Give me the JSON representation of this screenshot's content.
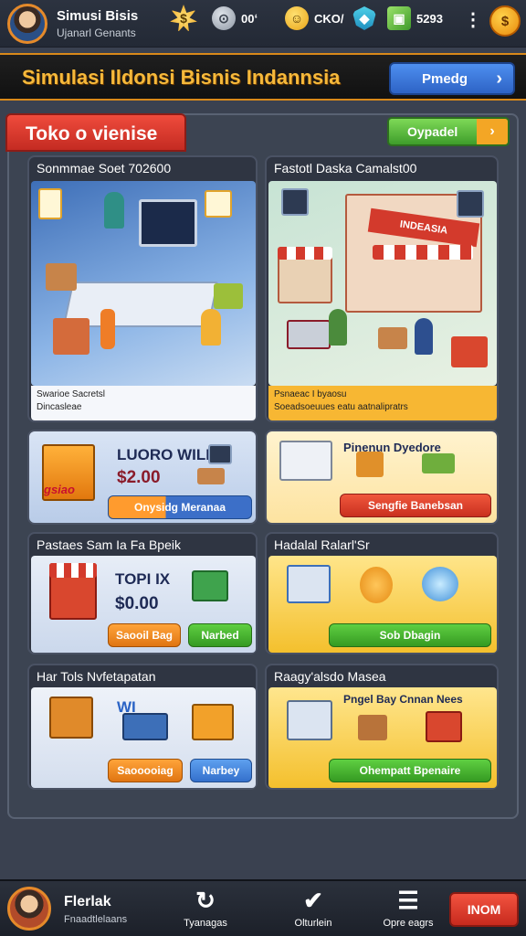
{
  "hud": {
    "player_name": "Simusi Bisis",
    "player_sub": "Ujanarl Genants",
    "res_silver": "00ʻ",
    "res_gold": "CKO/",
    "res_gems": "5293",
    "menu_glyph": "⋮",
    "coin_glyph": "$"
  },
  "banner": {
    "title": "Simulasi Ildonsi Bisnis Indannsia",
    "button_label": "Pmedg",
    "button_chevron": "›"
  },
  "panel": {
    "tab_label": "Toko o vienise",
    "upgrade_label": "Oypadel",
    "upgrade_arrow": "›"
  },
  "cards": {
    "c1": {
      "title": "Sonmmae Soet 702600",
      "caption_line1": "Swarioe Sacretsl",
      "caption_line2": "Dincasleae"
    },
    "c2": {
      "title": "Fastotl Daska Camalst00",
      "caption_line1": "Psnaeac I byaosu",
      "caption_line2": "Soeadsoeuues eatu aatnalipratrs",
      "store_sign": "INDEASIA"
    },
    "c3": {
      "label": "LUORO WILL",
      "price": "$2.00",
      "pill": "Onysidg Meranaa",
      "crate_text": "gsiao"
    },
    "c4": {
      "label": "Pinenun Dyedore",
      "pill": "Sengfie Banebsan"
    },
    "c5": {
      "title": "Pastaes Sam Ia Fa Bpeik",
      "label": "TOPI IX",
      "price": "$0.00",
      "pill_left": "Saooil Bag",
      "pill_right": "Narbed"
    },
    "c6": {
      "title": "Hadalal Ralarl'Sr",
      "pill": "Sob Dbagin"
    },
    "c7": {
      "title": "Har Tols Nvfetapatan",
      "label": "WI",
      "pill_left": "Saooooiag",
      "pill_right": "Narbey"
    },
    "c8": {
      "title": "Raagy'alsdo Masea",
      "label": "Pngel Bay Cnnan Nees",
      "pill": "Ohempatt Bpenaire"
    }
  },
  "bottom": {
    "name": "Flerlak",
    "sub": "Fnaadtlelaans",
    "nav1_label": "Tyanagas",
    "nav1_icon": "↻",
    "nav2_label": "Olturlein",
    "nav2_icon": "✔",
    "nav3_label": "Opre eagrs",
    "nav3_icon": "☰",
    "action_label": "INOM"
  },
  "colors": {
    "accent_orange": "#f6b93b",
    "tab_red": "#e3443a",
    "upgrade_green": "#4caf3a",
    "nav_blue": "#3d7ae0"
  }
}
